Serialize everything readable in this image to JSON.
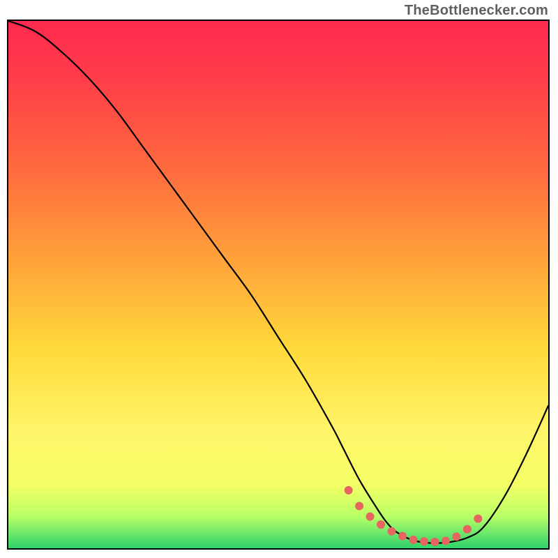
{
  "watermark_text": "TheBottlenecker.com",
  "colors": {
    "top": "#ff2a4f",
    "mid_upper": "#ff7a3a",
    "mid": "#ffd93a",
    "mid_lower": "#fff56a",
    "bottom": "#2fd36a",
    "line": "#000000",
    "dot": "#e4665f",
    "border": "#000000"
  },
  "chart_data": {
    "type": "line",
    "title": "",
    "xlabel": "",
    "ylabel": "",
    "xlim": [
      0,
      100
    ],
    "ylim": [
      0,
      100
    ],
    "series": [
      {
        "name": "bottleneck-curve",
        "x": [
          0,
          5,
          10,
          15,
          20,
          25,
          30,
          35,
          40,
          45,
          50,
          55,
          60,
          62,
          65,
          68,
          70,
          72,
          75,
          78,
          80,
          82,
          85,
          88,
          92,
          96,
          100
        ],
        "y": [
          100,
          98,
          94,
          89,
          83,
          76,
          69,
          62,
          55,
          48,
          40,
          32,
          23,
          19,
          13,
          8,
          5,
          3,
          1.5,
          1,
          1,
          1.2,
          2,
          4,
          10,
          18,
          27
        ]
      }
    ],
    "markers": {
      "name": "bottom-dots",
      "x": [
        63,
        65,
        67,
        69,
        71,
        73,
        75,
        77,
        79,
        81,
        83,
        85,
        87
      ],
      "y": [
        11,
        8,
        6,
        4.5,
        3.2,
        2.3,
        1.6,
        1.3,
        1.2,
        1.4,
        2.2,
        3.6,
        5.6
      ]
    },
    "gradient_stops": [
      {
        "offset": 0.0,
        "color": "#ff2a4f"
      },
      {
        "offset": 0.1,
        "color": "#ff3b4a"
      },
      {
        "offset": 0.28,
        "color": "#ff6a3e"
      },
      {
        "offset": 0.45,
        "color": "#ffa13a"
      },
      {
        "offset": 0.62,
        "color": "#ffd93a"
      },
      {
        "offset": 0.78,
        "color": "#fff56a"
      },
      {
        "offset": 0.88,
        "color": "#f4ff66"
      },
      {
        "offset": 0.94,
        "color": "#b8ff66"
      },
      {
        "offset": 0.97,
        "color": "#6fe86b"
      },
      {
        "offset": 1.0,
        "color": "#2fd36a"
      }
    ]
  }
}
